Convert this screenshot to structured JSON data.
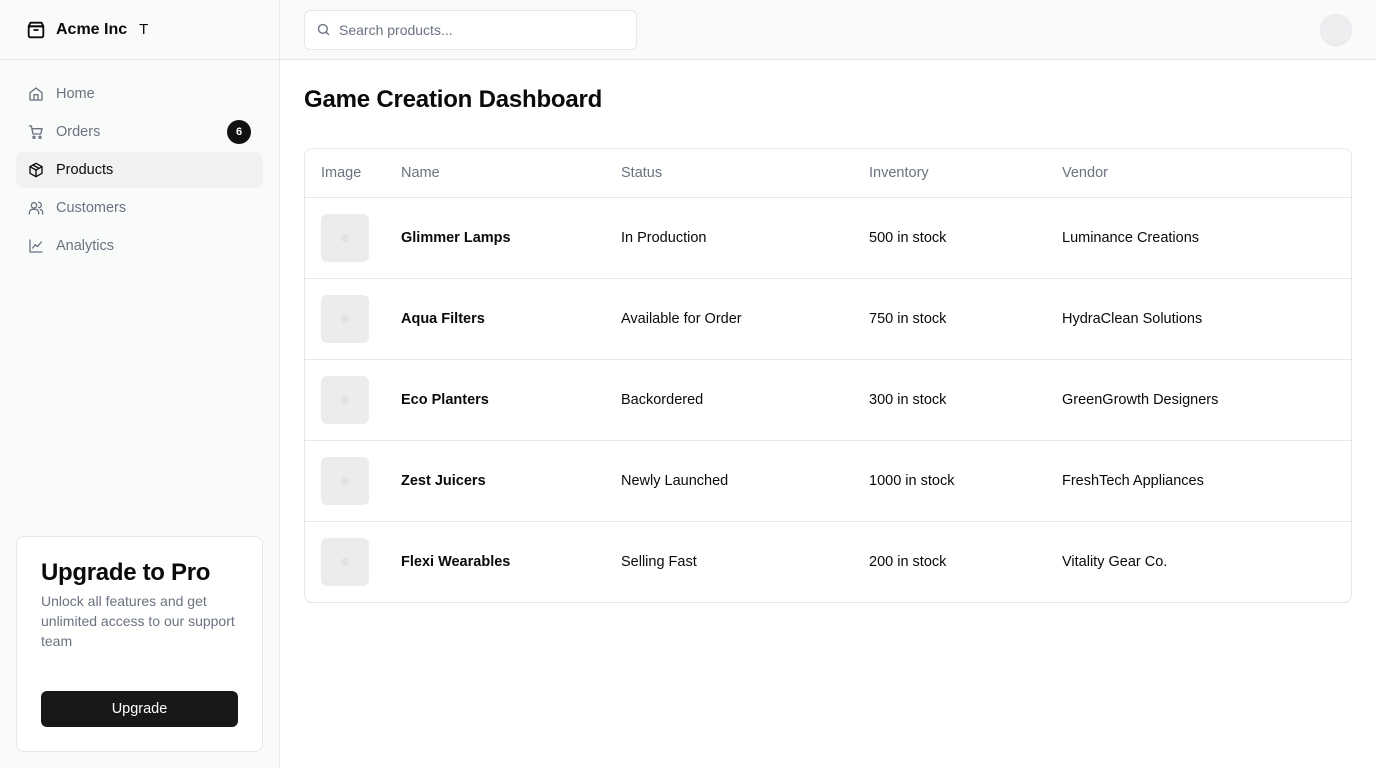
{
  "brand": {
    "name": "Acme Inc",
    "extra": "T"
  },
  "nav": {
    "items": [
      {
        "label": "Home",
        "icon": "home-icon"
      },
      {
        "label": "Orders",
        "icon": "cart-icon",
        "badge": "6"
      },
      {
        "label": "Products",
        "icon": "package-icon",
        "active": true
      },
      {
        "label": "Customers",
        "icon": "users-icon"
      },
      {
        "label": "Analytics",
        "icon": "line-chart-icon"
      }
    ]
  },
  "upgrade": {
    "title": "Upgrade to Pro",
    "description": "Unlock all features and get unlimited access to our support team",
    "button_label": "Upgrade"
  },
  "search": {
    "placeholder": "Search products...",
    "value": ""
  },
  "page": {
    "title": "Game Creation Dashboard"
  },
  "table": {
    "headers": [
      "Image",
      "Name",
      "Status",
      "Inventory",
      "Vendor"
    ],
    "rows": [
      {
        "name": "Glimmer Lamps",
        "status": "In Production",
        "inventory": "500 in stock",
        "vendor": "Luminance Creations"
      },
      {
        "name": "Aqua Filters",
        "status": "Available for Order",
        "inventory": "750 in stock",
        "vendor": "HydraClean Solutions"
      },
      {
        "name": "Eco Planters",
        "status": "Backordered",
        "inventory": "300 in stock",
        "vendor": "GreenGrowth Designers"
      },
      {
        "name": "Zest Juicers",
        "status": "Newly Launched",
        "inventory": "1000 in stock",
        "vendor": "FreshTech Appliances"
      },
      {
        "name": "Flexi Wearables",
        "status": "Selling Fast",
        "inventory": "200 in stock",
        "vendor": "Vitality Gear Co."
      }
    ]
  },
  "colors": {
    "accent_dark": "#18181b",
    "muted_text": "#6b7280",
    "border": "#e5e7eb",
    "sidebar_bg": "#f9fafa",
    "active_item_bg": "#f0f1f3"
  }
}
